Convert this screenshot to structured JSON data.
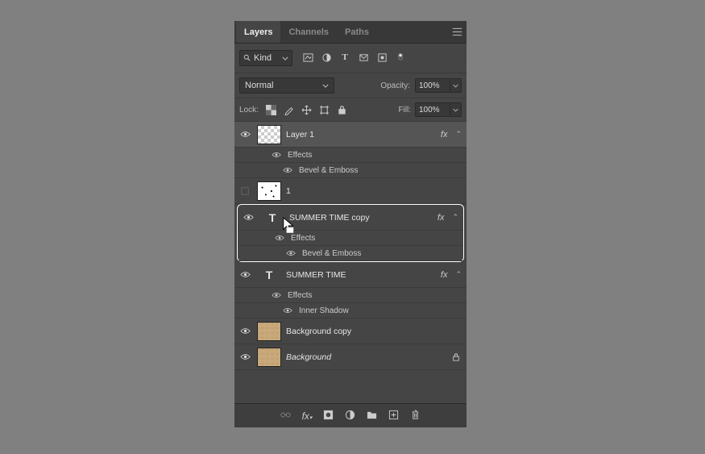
{
  "tabs": {
    "layers": "Layers",
    "channels": "Channels",
    "paths": "Paths"
  },
  "filter": {
    "kind_label": "Kind"
  },
  "blend": {
    "mode": "Normal",
    "opacity_label": "Opacity:",
    "opacity_value": "100%"
  },
  "lock": {
    "label": "Lock:",
    "fill_label": "Fill:",
    "fill_value": "100%"
  },
  "fx_label": "fx",
  "effects_label": "Effects",
  "layers": {
    "l0": {
      "name": "Layer 1"
    },
    "l0e0": "Bevel & Emboss",
    "l1": {
      "name": "1"
    },
    "l2": {
      "name": "SUMMER TIME copy"
    },
    "l2e0": "Bevel & Emboss",
    "l3": {
      "name": "SUMMER TIME"
    },
    "l3e0": "Inner Shadow",
    "l4": {
      "name": "Background copy"
    },
    "l5": {
      "name": "Background"
    }
  }
}
